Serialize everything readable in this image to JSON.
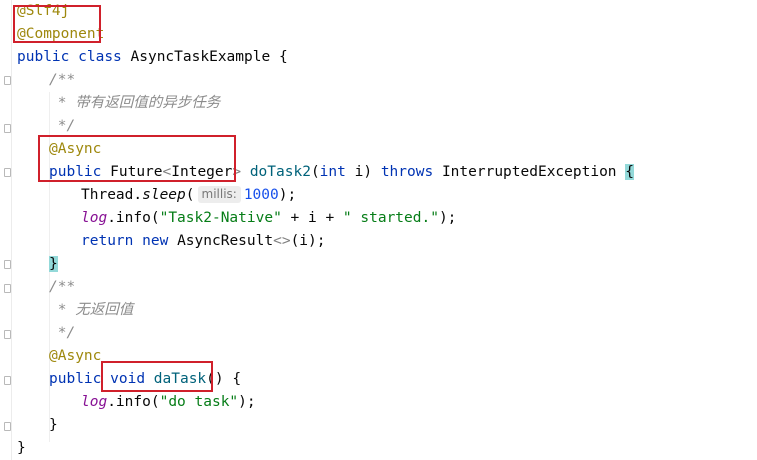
{
  "code": {
    "l1": "@Slf4j",
    "l2": "@Component",
    "l3_kw1": "public",
    "l3_kw2": "class",
    "l3_name": "AsyncTaskExample",
    "l3_brace": "{",
    "c1_open": "/**",
    "c1_text": " * 带有返回值的异步任务",
    "c1_close": " */",
    "ann_async": "@Async",
    "m1_public": "public",
    "m1_type": "Future",
    "m1_lt": "<",
    "m1_generic": "Integer",
    "m1_gt": ">",
    "m1_name": "doTask2",
    "m1_paren_open": "(",
    "m1_int": "int",
    "m1_param": " i",
    "m1_paren_close": ")",
    "m1_throws": "throws",
    "m1_exc": "InterruptedException",
    "m1_brace": "{",
    "s1_class": "Thread.",
    "s1_method": "sleep",
    "s1_paren": "(",
    "s1_hint": "millis:",
    "s1_num": "1000",
    "s1_end": ");",
    "s2_field": "log",
    "s2_dot_info": ".info(",
    "s2_str1": "\"Task2-Native\"",
    "s2_mid": " + i + ",
    "s2_str2": "\" started.\"",
    "s2_end": ");",
    "s3_return": "return",
    "s3_new": "new",
    "s3_class": "AsyncResult",
    "s3_diamond": "<>",
    "s3_end": "(i);",
    "m1_close": "}",
    "c2_open": "/**",
    "c2_text": " * 无返回值",
    "c2_close": " */",
    "ann_async2": "@Async",
    "m2_public": "public",
    "m2_void": "void",
    "m2_name": "daTask",
    "m2_parens": "()",
    "m2_brace": "{",
    "t1_field": "log",
    "t1_info": ".info(",
    "t1_str": "\"do task\"",
    "t1_end": ");",
    "m2_close": "}",
    "class_close": "}"
  }
}
